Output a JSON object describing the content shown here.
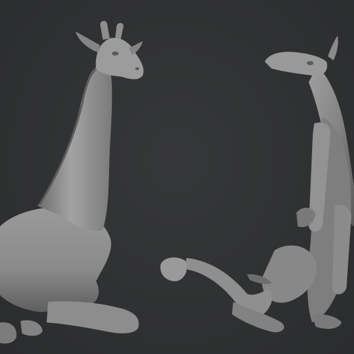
{
  "viewport": {
    "background_color": "#323334",
    "clay_color": "#8c8c8c",
    "clay_highlight": "#b3b3b3",
    "clay_shadow": "#4a4a4a"
  },
  "models": [
    {
      "name": "giraffe-lying-pose",
      "view": "front-three-quarter"
    },
    {
      "name": "giraffe-lying-pose",
      "view": "underside"
    }
  ]
}
